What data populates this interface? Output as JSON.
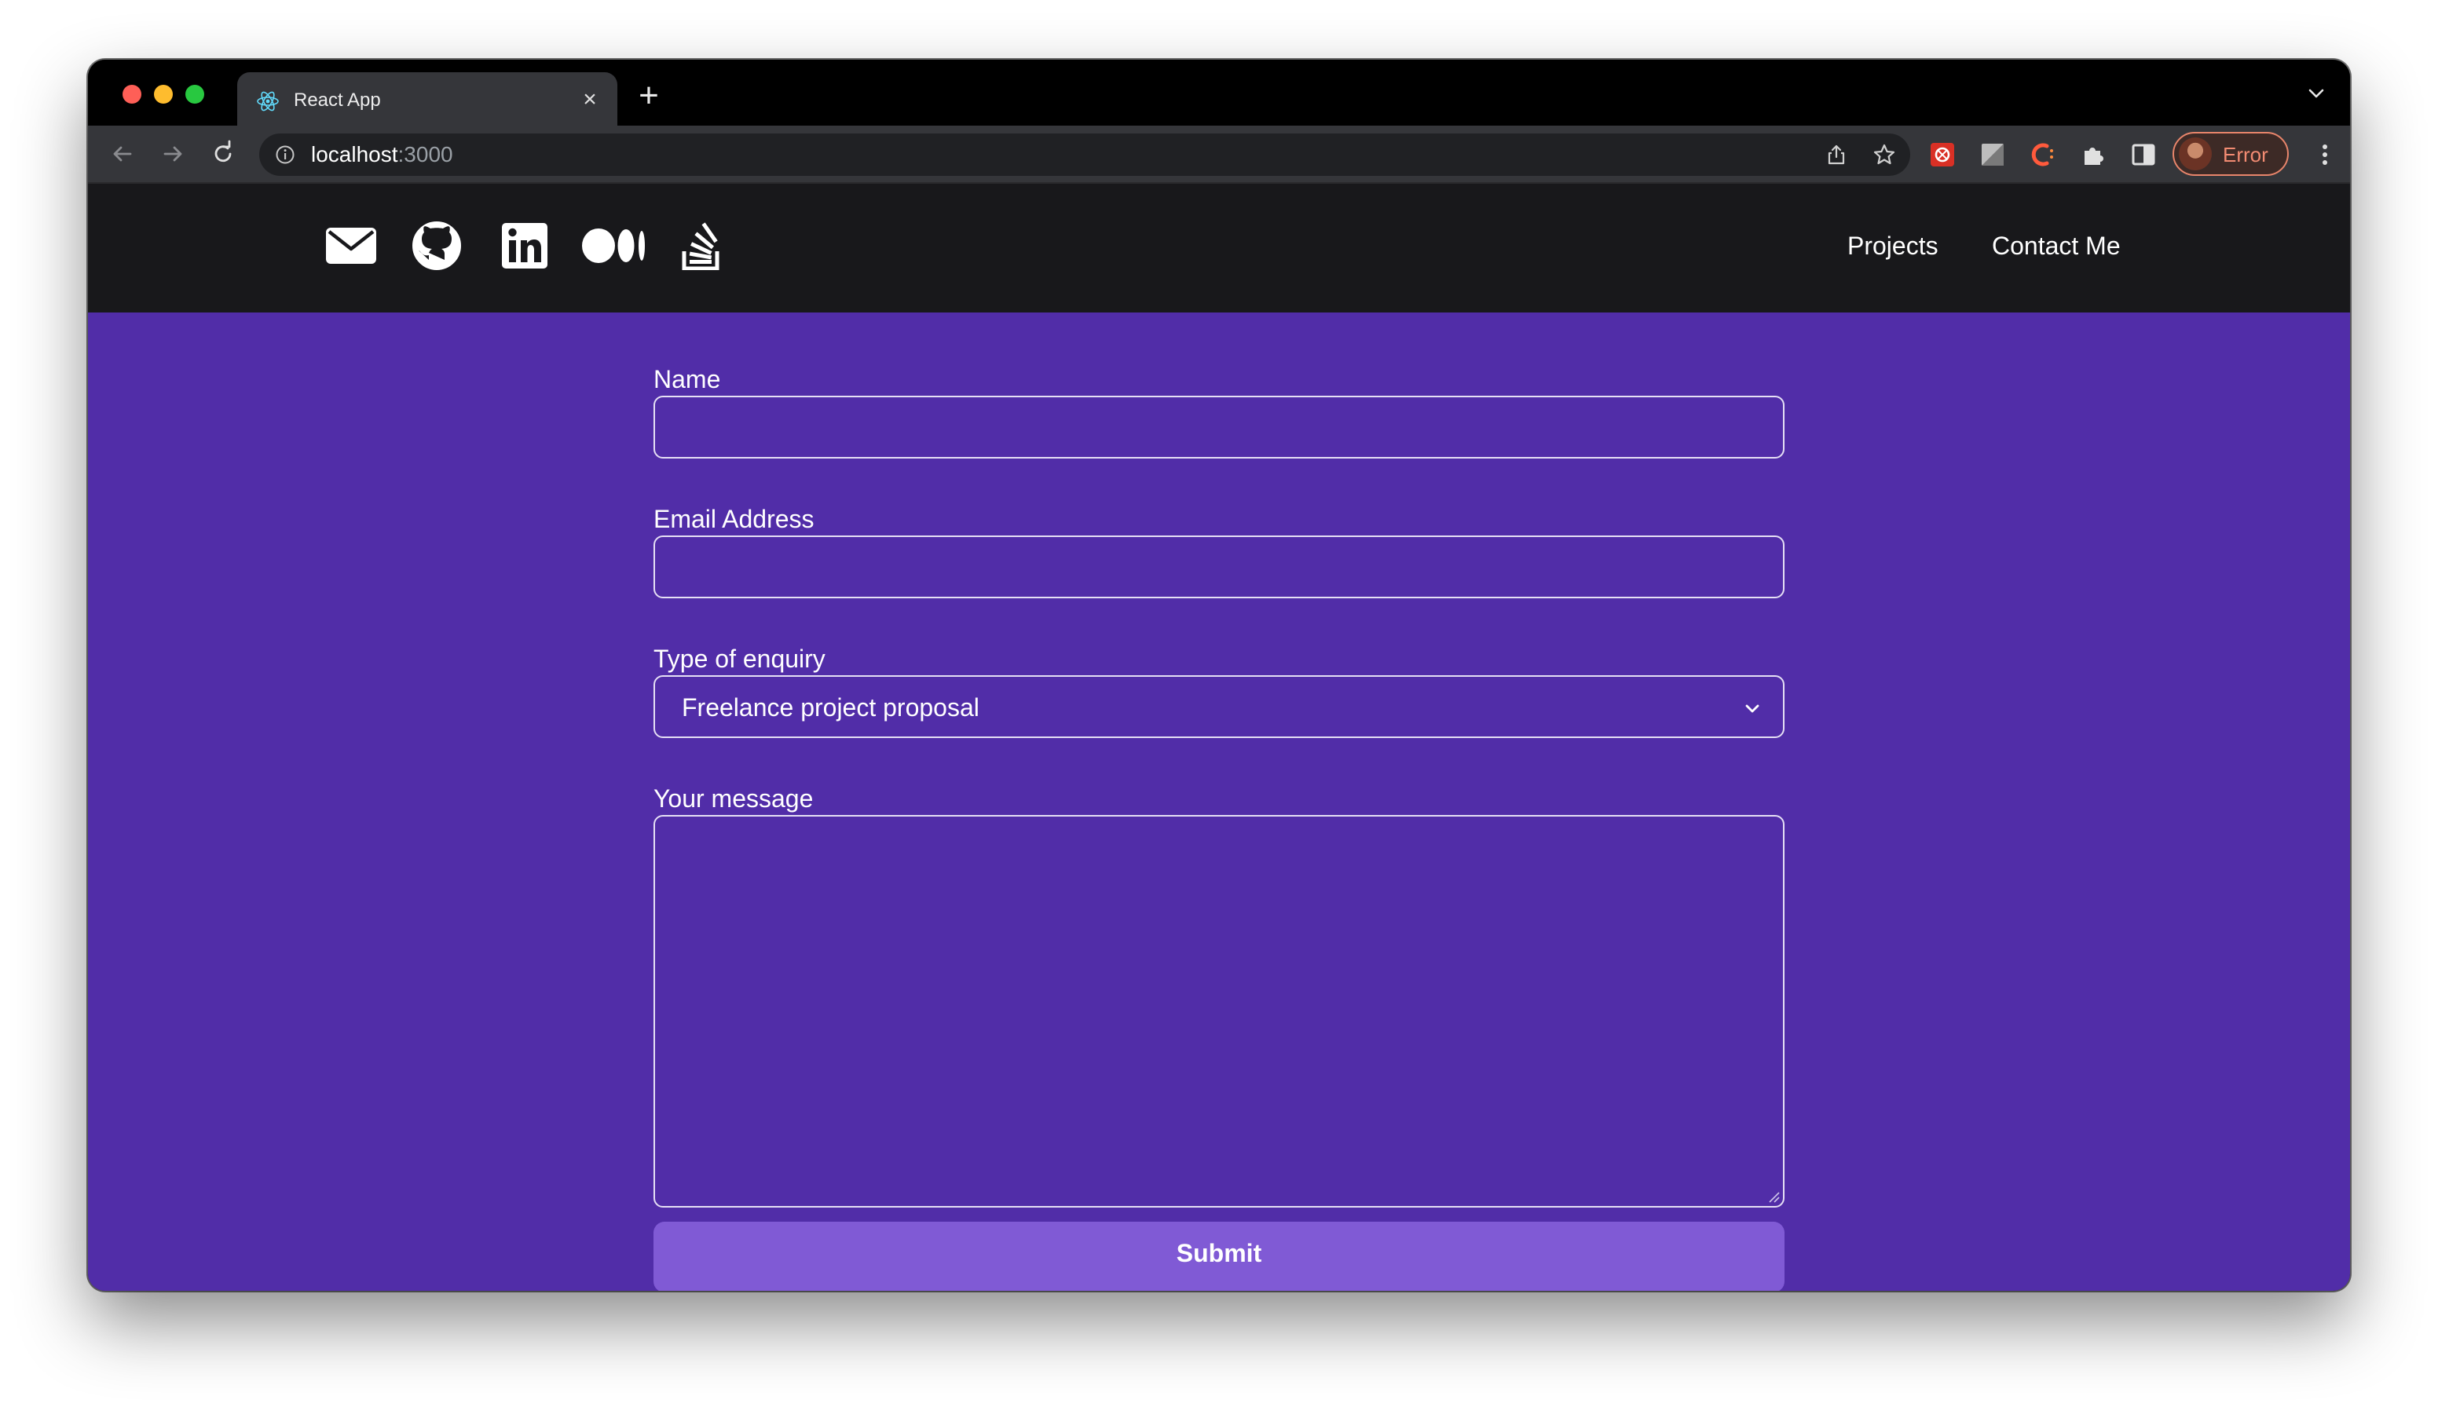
{
  "browser": {
    "tab": {
      "title": "React App",
      "favicon": "react-icon",
      "close": "×"
    },
    "new_tab": "+",
    "omnibox": {
      "host": "localhost",
      "port": ":3000"
    },
    "profile": {
      "label": "Error"
    }
  },
  "header": {
    "social_icons": [
      "mail-icon",
      "github-icon",
      "linkedin-icon",
      "medium-icon",
      "stackoverflow-icon"
    ],
    "nav": {
      "projects": "Projects",
      "contact": "Contact Me"
    }
  },
  "form": {
    "name": {
      "label": "Name",
      "value": ""
    },
    "email": {
      "label": "Email Address",
      "value": ""
    },
    "enquiry": {
      "label": "Type of enquiry",
      "selected": "Freelance project proposal"
    },
    "message": {
      "label": "Your message",
      "value": ""
    },
    "submit_label": "Submit"
  },
  "colors": {
    "page_background": "#512da8",
    "header_background": "#18181b",
    "submit_button": "#805ad5",
    "text": "#ffffff"
  }
}
